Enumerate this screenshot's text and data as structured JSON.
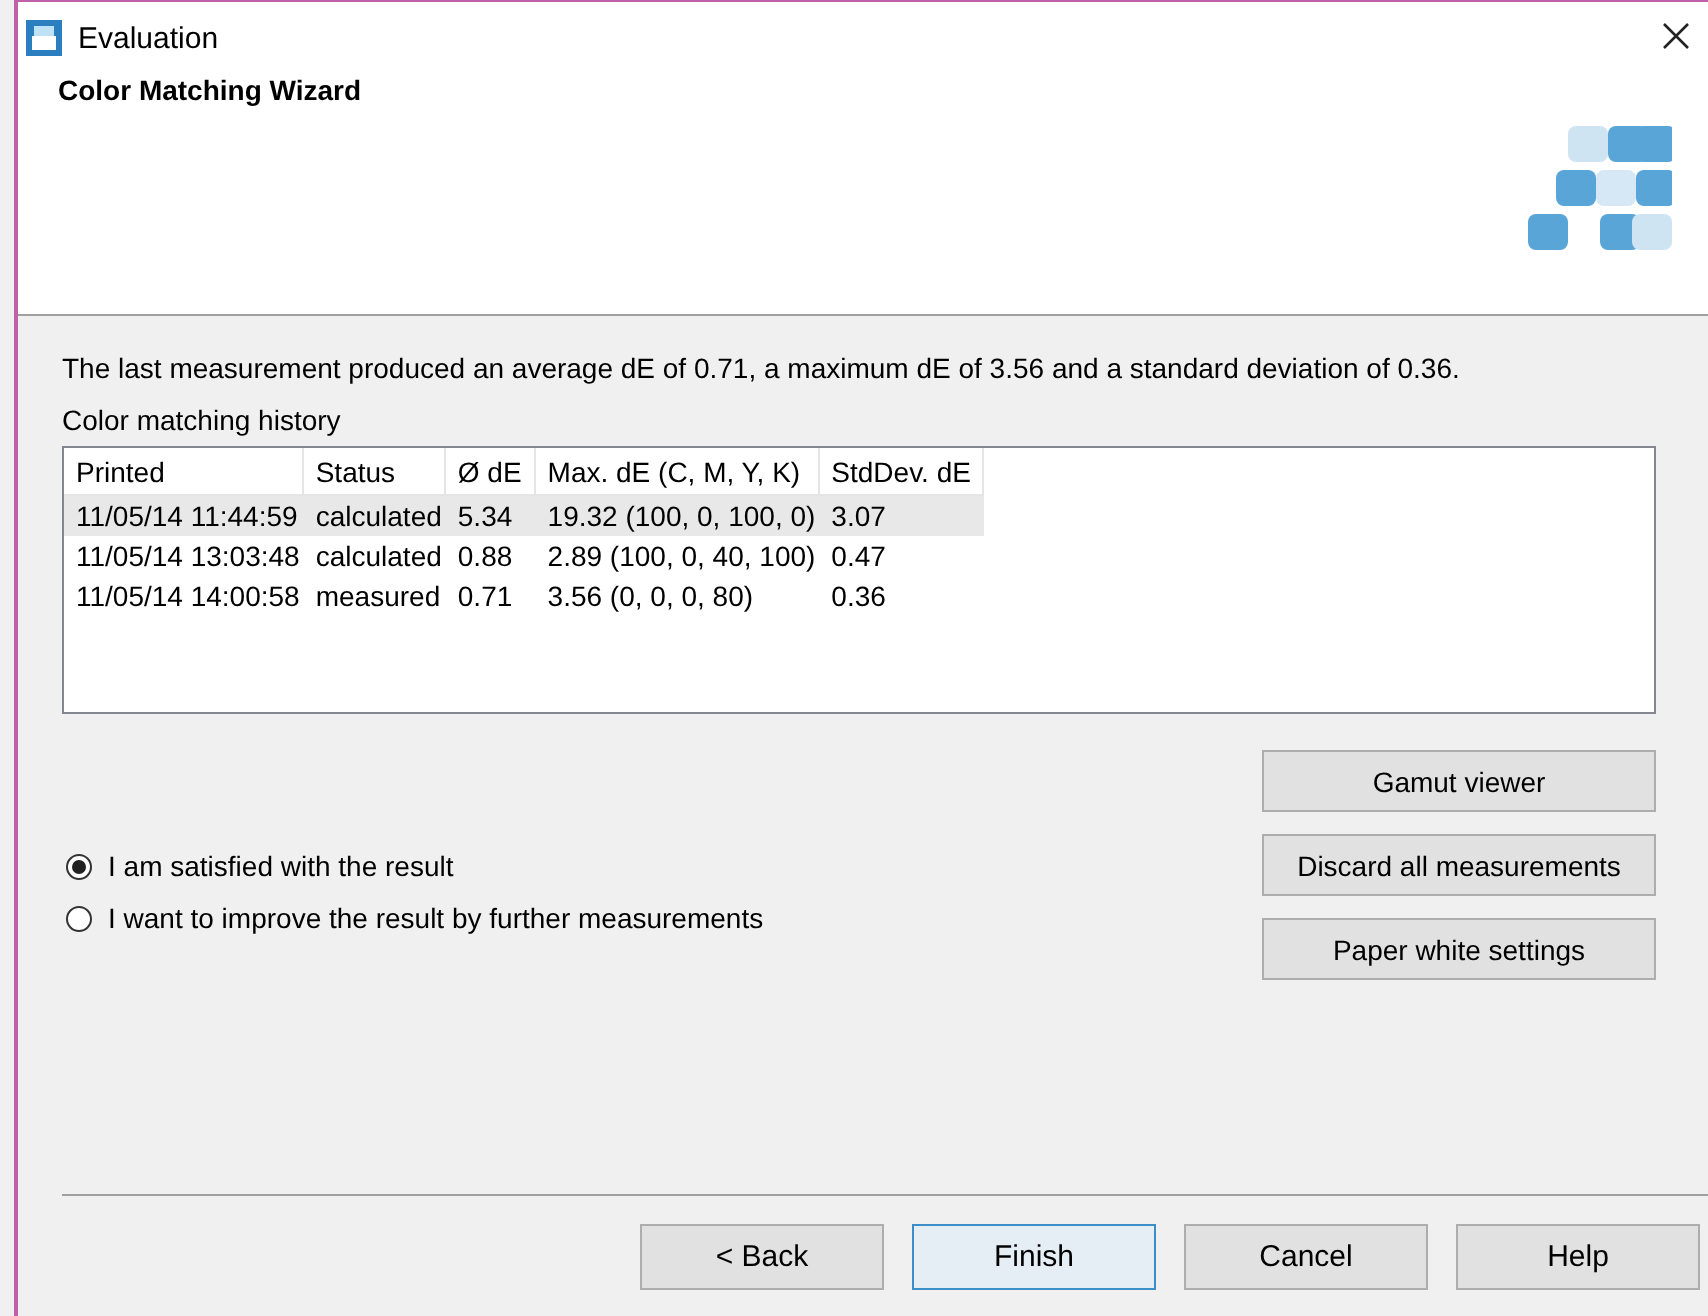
{
  "window": {
    "title": "Evaluation"
  },
  "header": {
    "title": "Color Matching Wizard"
  },
  "summary": "The last measurement produced an average dE of 0.71, a maximum dE of 3.56 and a standard deviation of 0.36.",
  "history": {
    "label": "Color matching history",
    "columns": [
      "Printed",
      "Status",
      "Ø dE",
      "Max. dE (C, M, Y, K)",
      "StdDev. dE"
    ],
    "rows": [
      {
        "selected": true,
        "cells": [
          "11/05/14 11:44:59",
          "calculated",
          "5.34",
          "19.32  (100, 0, 100, 0)",
          "3.07"
        ]
      },
      {
        "selected": false,
        "cells": [
          "11/05/14 13:03:48",
          "calculated",
          "0.88",
          "2.89  (100, 0, 40, 100)",
          "0.47"
        ]
      },
      {
        "selected": false,
        "cells": [
          "11/05/14 14:00:58",
          "measured",
          "0.71",
          "3.56  (0, 0, 0, 80)",
          "0.36"
        ]
      }
    ]
  },
  "options": [
    {
      "label": "I am satisfied with the result",
      "selected": true
    },
    {
      "label": "I want to improve the result by further measurements",
      "selected": false
    }
  ],
  "side_buttons": [
    "Gamut viewer",
    "Discard all measurements",
    "Paper white settings"
  ],
  "footer_buttons": [
    {
      "label": "< Back",
      "default": false
    },
    {
      "label": "Finish",
      "default": true
    },
    {
      "label": "Cancel",
      "default": false
    },
    {
      "label": "Help",
      "default": false
    }
  ]
}
